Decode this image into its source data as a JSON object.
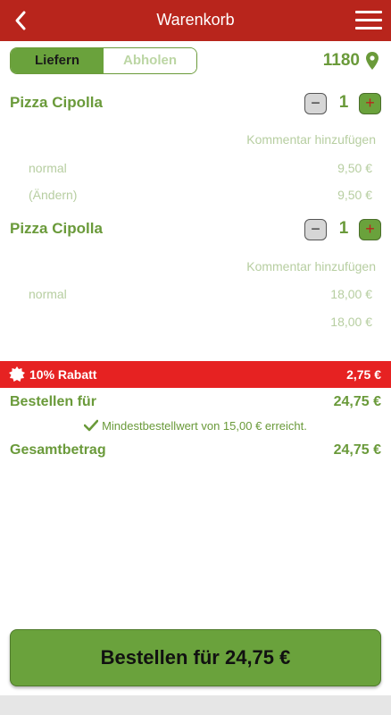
{
  "header": {
    "title": "Warenkorb",
    "back_icon": "chevron-left-icon",
    "menu_icon": "hamburger-menu-icon"
  },
  "delivery_toggle": {
    "options": [
      "Liefern",
      "Abholen"
    ],
    "selected": "Liefern"
  },
  "postcode": {
    "value": "1180",
    "icon": "map-pin-icon"
  },
  "items": [
    {
      "name": "Pizza Cipolla",
      "quantity": "1",
      "comment_link": "Kommentar hinzufügen",
      "options": [
        {
          "label": "normal",
          "price": "9,50 €"
        },
        {
          "label": "(Ändern)",
          "price": "9,50 €"
        }
      ]
    },
    {
      "name": "Pizza Cipolla",
      "quantity": "1",
      "comment_link": "Kommentar hinzufügen",
      "options": [
        {
          "label": "normal",
          "price": "18,00 €"
        },
        {
          "label": "",
          "price": "18,00 €"
        }
      ]
    }
  ],
  "discount": {
    "label": "10% Rabatt",
    "amount": "2,75 €",
    "icon": "badge-star-icon"
  },
  "order_for": {
    "label": "Bestellen für",
    "value": "24,75 €"
  },
  "minimum_message": "Mindestbestellwert von 15,00 € erreicht.",
  "total": {
    "label": "Gesamtbetrag",
    "value": "24,75 €"
  },
  "order_button": {
    "label": "Bestellen für 24,75 €"
  },
  "colors": {
    "header_red": "#b8251c",
    "discount_red": "#e62222",
    "green": "#6a9a3a",
    "button_green": "#6aa23c",
    "muted_green": "#b7cea1"
  }
}
